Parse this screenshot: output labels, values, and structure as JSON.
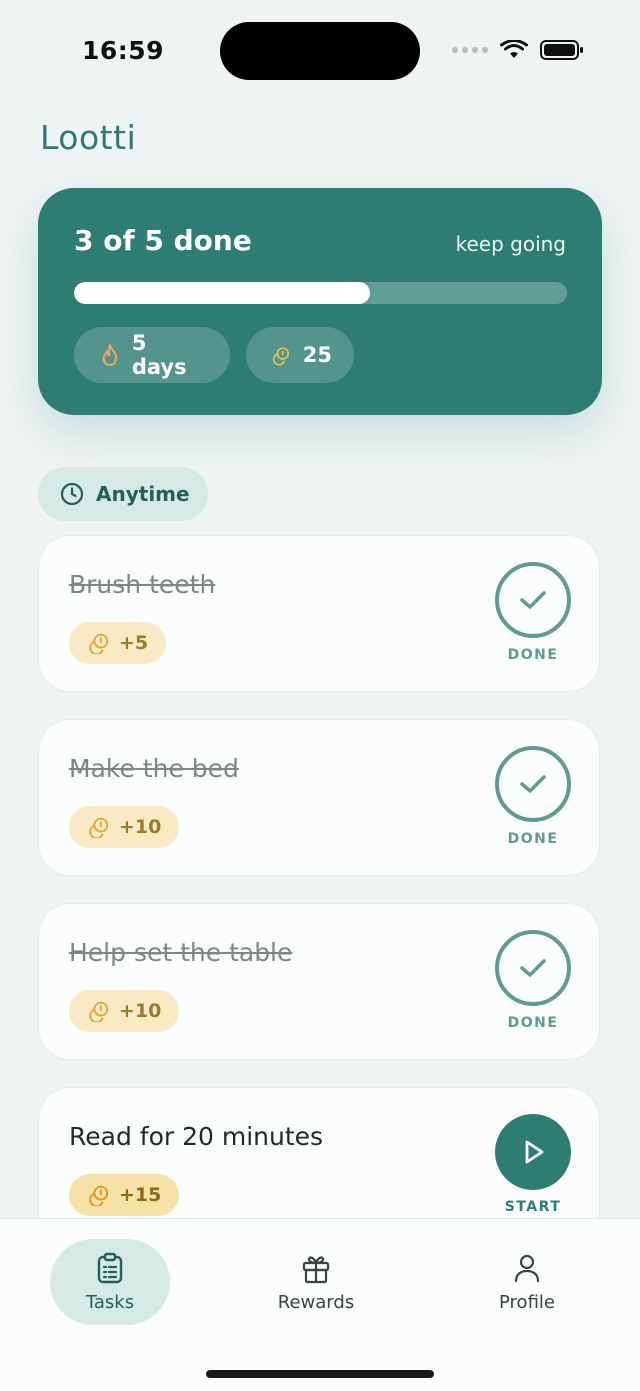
{
  "status_bar": {
    "time": "16:59"
  },
  "app": {
    "title": "Lootti"
  },
  "progress": {
    "title": "3 of 5 done",
    "subtitle": "keep going",
    "completed": 3,
    "total": 5,
    "fraction": 0.6,
    "streak_label": "5 days",
    "coins_label": "25"
  },
  "section": {
    "label": "Anytime"
  },
  "tasks": [
    {
      "title": "Brush teeth",
      "reward": "+5",
      "status": "DONE"
    },
    {
      "title": "Make the bed",
      "reward": "+10",
      "status": "DONE"
    },
    {
      "title": "Help set the table",
      "reward": "+10",
      "status": "DONE"
    },
    {
      "title": "Read for 20 minutes",
      "reward": "+15",
      "status": "START"
    }
  ],
  "tabs": [
    {
      "label": "Tasks",
      "icon": "clipboard-icon"
    },
    {
      "label": "Rewards",
      "icon": "gift-icon"
    },
    {
      "label": "Profile",
      "icon": "person-icon"
    }
  ],
  "colors": {
    "primary": "#2e7d73",
    "coin": "#e0a52a",
    "background": "#eef4f3"
  }
}
